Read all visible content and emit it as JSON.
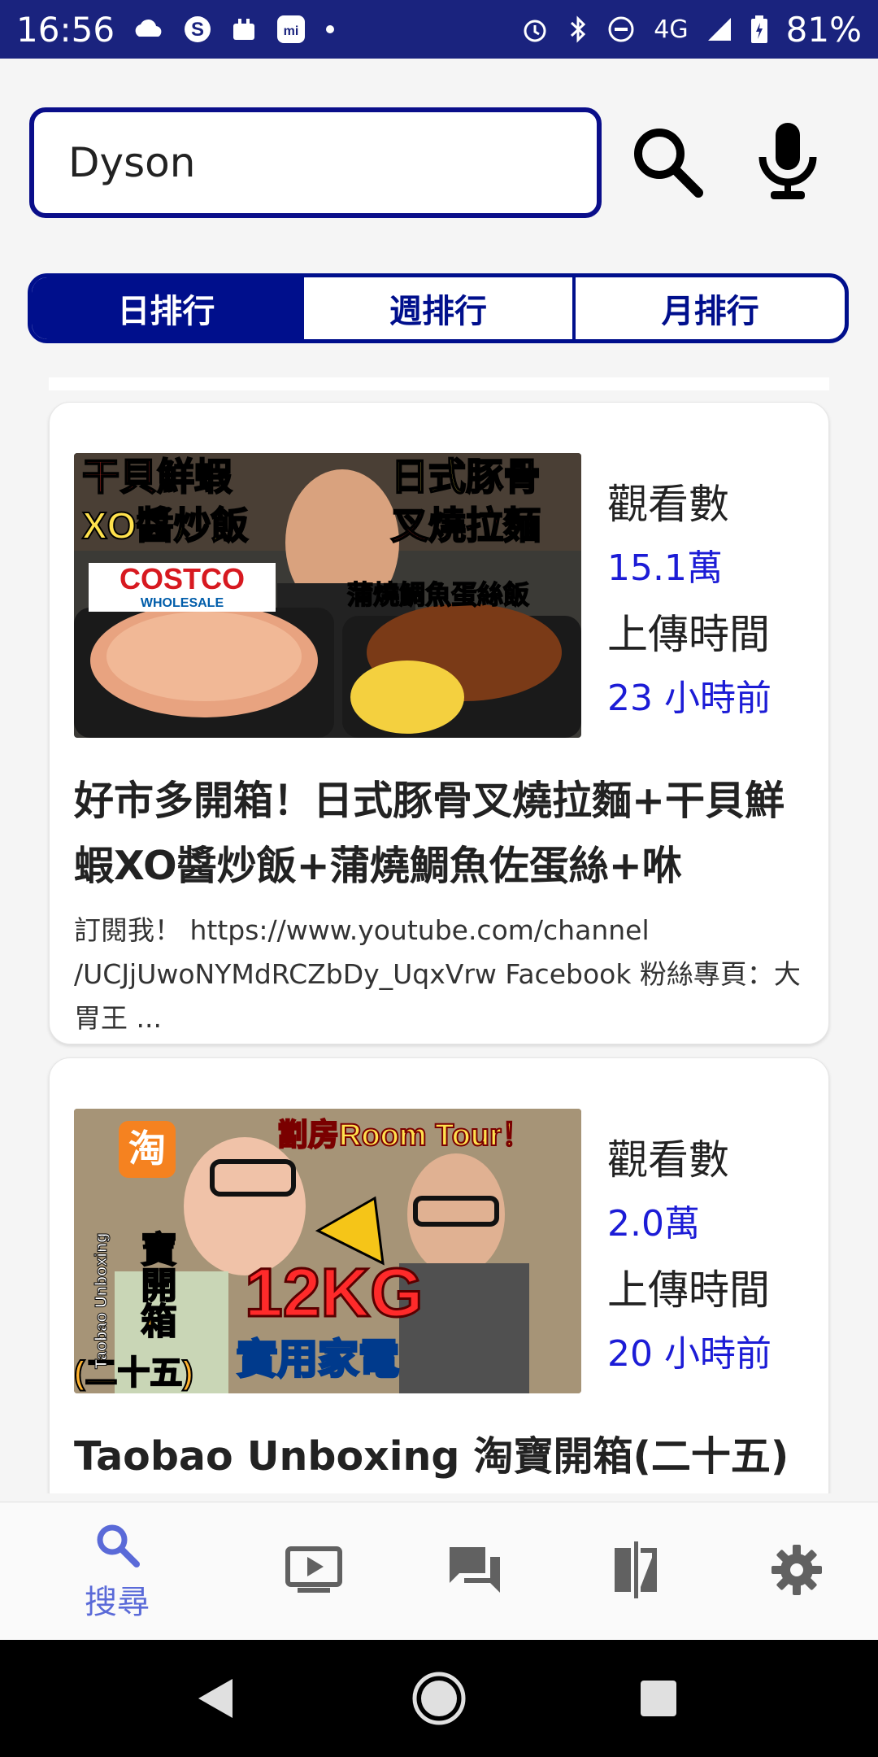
{
  "status_bar": {
    "time": "16:56",
    "network": "4G",
    "battery": "81%"
  },
  "search": {
    "query": "Dyson"
  },
  "tabs": [
    {
      "label": "日排行"
    },
    {
      "label": "週排行"
    },
    {
      "label": "月排行"
    }
  ],
  "videos": [
    {
      "views_label": "觀看數",
      "views": "15.1萬",
      "upload_label": "上傳時間",
      "uploaded": "23 小時前",
      "title": "好市多開箱！日式豚骨叉燒拉麵+干貝鮮蝦XO醬炒飯+蒲燒鯛魚佐蛋絲+咻",
      "description": "訂閱我！ https://www.youtube.com/channel /UCJjUwoNYMdRCZbDy_UqxVrw Facebook 粉絲專頁：大胃王 ...",
      "thumb_text": {
        "left_top": "干貝鮮蝦",
        "left_mid": "XO醬炒飯",
        "right_top": "日式豚骨",
        "right_mid": "叉燒拉麵",
        "right_bottom": "蒲燒鯛魚蛋絲飯",
        "brand_top": "COSTCO",
        "brand_bottom": "WHOLESALE"
      }
    },
    {
      "views_label": "觀看數",
      "views": "2.0萬",
      "upload_label": "上傳時間",
      "uploaded": "20 小時前",
      "title": "Taobao Unboxing 淘寶開箱(二十五)",
      "thumb_text": {
        "top": "劏房Room Tour！",
        "left_badge": "淘",
        "left_vertical": "寶開箱",
        "left_bottom": "(二十五)",
        "side": "Taobao Unboxing",
        "weight": "12KG",
        "bottom": "實用家電"
      }
    }
  ],
  "bottom_nav": [
    {
      "icon": "search-icon",
      "label": "搜尋",
      "active": true
    },
    {
      "icon": "video-icon"
    },
    {
      "icon": "chat-icon"
    },
    {
      "icon": "compare-icon"
    },
    {
      "icon": "settings-icon"
    }
  ],
  "colors": {
    "primary": "#000f8c",
    "status_bar": "#1a237e",
    "value_blue": "#1c1cd6",
    "active_nav": "#5a6ad8"
  }
}
